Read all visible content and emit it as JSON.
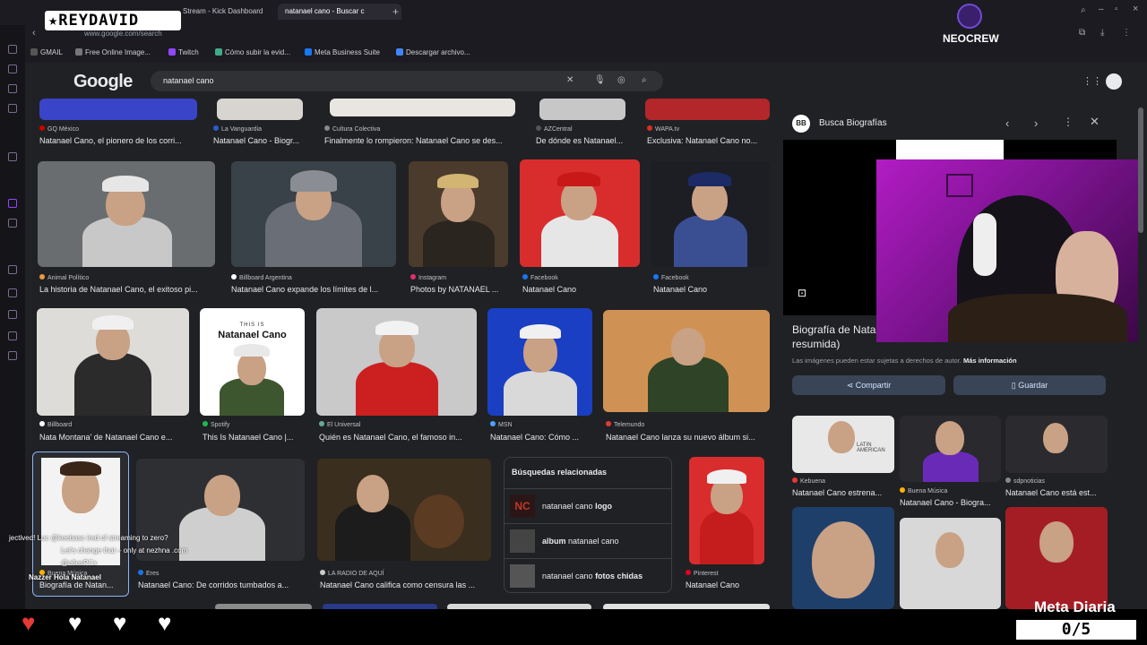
{
  "browser": {
    "tabs": [
      {
        "label": "Stream - Kick Dashboard",
        "active": false
      },
      {
        "label": "natanael cano - Buscar c",
        "active": true
      }
    ],
    "url": "www.google.com/search",
    "bookmarks": [
      "GMAIL",
      "Free Online Image...",
      "Twitch",
      "Cómo subir la evid...",
      "Meta Business Suite",
      "Descargar archivo..."
    ]
  },
  "search": {
    "logo": "Google",
    "query": "natanael cano"
  },
  "results_row0": [
    {
      "source": "GQ México",
      "title": "Natanael Cano, el pionero de los corri..."
    },
    {
      "source": "La Vanguardia",
      "title": "Natanael Cano - Biogr..."
    },
    {
      "source": "Cultura Colectiva",
      "title": "Finalmente lo rompieron: Natanael Cano se des..."
    },
    {
      "source": "AZCentral",
      "title": "De dónde es Natanael..."
    },
    {
      "source": "WAPA.tv",
      "title": "Exclusiva: Natanael Cano no..."
    }
  ],
  "results_row1": [
    {
      "source": "Animal Político",
      "title": "La historia de Natanael Cano, el exitoso pi..."
    },
    {
      "source": "Billboard Argentina",
      "title": "Natanael Cano expande los límites de l..."
    },
    {
      "source": "Instagram",
      "title": "Photos by NATANAEL ..."
    },
    {
      "source": "Facebook",
      "title": "Natanael Cano"
    },
    {
      "source": "Facebook",
      "title": "Natanael Cano"
    }
  ],
  "results_row2": [
    {
      "source": "Billboard",
      "title": "Nata Montana' de Natanael Cano e..."
    },
    {
      "source": "Spotify",
      "title": "This Is Natanael Cano |..."
    },
    {
      "source": "El Universal",
      "title": "Quién es Natanael Cano, el famoso in..."
    },
    {
      "source": "MSN",
      "title": "Natanael Cano: Cómo ..."
    },
    {
      "source": "Telemundo",
      "title": "Natanael Cano lanza su nuevo álbum si..."
    }
  ],
  "spotify_card": {
    "line1": "THIS IS",
    "line2": "Natanael Cano"
  },
  "results_row3": [
    {
      "source": "Buena Música",
      "title": "Biografía de Natan..."
    },
    {
      "source": "Eres",
      "title": "Natanael Cano: De corridos tumbados a..."
    },
    {
      "source": "LA RADIO DE AQUÍ",
      "title": "Natanael Cano califica como censura las ..."
    },
    {
      "source": "Pinterest",
      "title": "Natanael Cano"
    }
  ],
  "related": {
    "heading": "Búsquedas relacionadas",
    "items": [
      {
        "prefix": "natanael cano ",
        "bold": "logo"
      },
      {
        "prefix": "album ",
        "bold": "natanael cano",
        "bold_first": false
      },
      {
        "prefix": "natanael cano ",
        "bold": "fotos chidas"
      }
    ]
  },
  "panel": {
    "site": "Busca Biografías",
    "title_line1": "Biografía de Nata",
    "title_line2": "resumida)",
    "notice": "Las imágenes pueden estar sujetas a derechos de autor.",
    "notice_link": "Más información",
    "share": "Compartir",
    "save": "Guardar",
    "thumbs": [
      {
        "source": "Kebuena",
        "title": "Natanael Cano estrena..."
      },
      {
        "source": "Buena Música",
        "title": "Natanael Cano - Biogra..."
      },
      {
        "source": "sdpnoticias",
        "title": "Natanael Cano está est..."
      }
    ],
    "thumb_text": "LATIN AMERICAN"
  },
  "overlay": {
    "streamer": "REYDAVID",
    "crew": "NEOCREW",
    "meta_label": "Meta Diaria",
    "meta_count": "0/5",
    "chat": [
      "jectived! Loc @keebasc  ired of streaming to zero?",
      "Let's change that – only at nezhna .com",
      "@c6esPCx",
      "Nazzer  Hola Natanael"
    ]
  },
  "colors": {
    "accent": "#8ab4f8",
    "page_bg": "#202124",
    "cam_bg": "#9a18b0"
  }
}
